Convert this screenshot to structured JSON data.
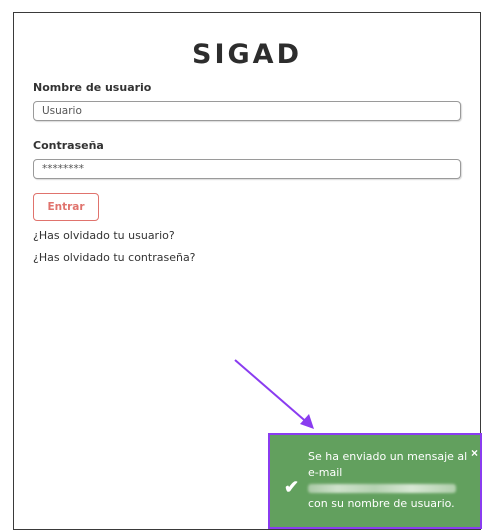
{
  "app": {
    "title": "SIGAD"
  },
  "login": {
    "username_label": "Nombre de usuario",
    "username_value": "Usuario",
    "password_label": "Contraseña",
    "password_value": "********",
    "submit_label": "Entrar",
    "forgot_user_link": "¿Has olvidado tu usuario?",
    "forgot_password_link": "¿Has olvidado tu contraseña?"
  },
  "toast": {
    "line1": "Se ha enviado un mensaje al",
    "line2": "e-mail",
    "line4": "con su nombre de usuario.",
    "close_symbol": "×",
    "icon": "check-icon"
  },
  "colors": {
    "toast_bg": "#62a05e",
    "toast_highlight": "#8a3cf0",
    "button_accent": "#e0736d",
    "annotation_arrow": "#8a3cf0"
  }
}
